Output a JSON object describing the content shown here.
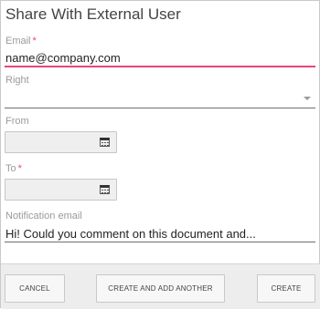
{
  "dialog": {
    "title": "Share With External User"
  },
  "email": {
    "label": "Email",
    "required_mark": "*",
    "value": "name@company.com"
  },
  "right": {
    "label": "Right",
    "value": ""
  },
  "from": {
    "label": "From",
    "value": ""
  },
  "to": {
    "label": "To",
    "required_mark": "*",
    "value": ""
  },
  "notification": {
    "label": "Notification email",
    "value": "Hi! Could you comment on this document and..."
  },
  "footer": {
    "cancel_label": "CANCEL",
    "create_another_label": "CREATE AND ADD ANOTHER",
    "create_label": "CREATE"
  },
  "colors": {
    "accent": "#e8457c",
    "footer_bg": "#ededed"
  },
  "icons": {
    "date_picker": "calendar-icon",
    "dropdown": "chevron-down-icon"
  }
}
